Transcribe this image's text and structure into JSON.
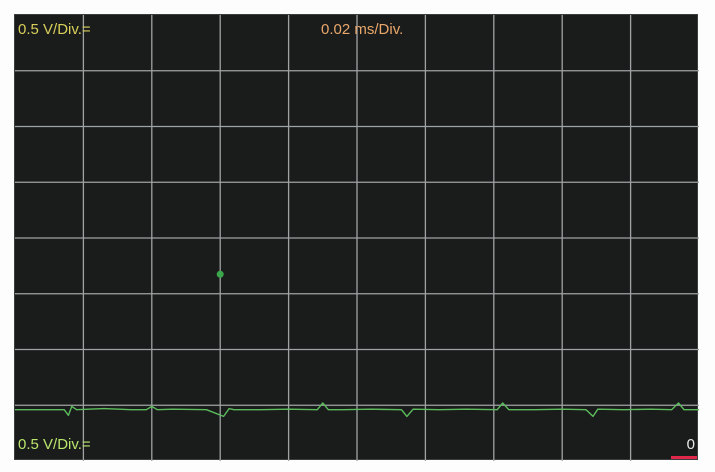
{
  "display": {
    "voltage_per_div_top": "0.5 V/Div.=",
    "time_per_div": "0.02 ms/Div.",
    "voltage_per_div_bottom": "0.5 V/Div.=",
    "zero_marker": "0"
  },
  "colors": {
    "screen_background": "#1a1c1c",
    "grid": "#9fa3a3",
    "trace": "#5cbc5c",
    "cursor_dot": "#3aa84a",
    "readout_volt": "#d8cf5a",
    "readout_time": "#e9a76a",
    "readout_volt_bottom": "#b9e56a",
    "zero_marker": "#e9e9e9",
    "zero_underline": "#e2284a"
  },
  "chart_data": {
    "type": "line",
    "title": "",
    "xlabel": "",
    "ylabel": "",
    "grid": true,
    "divisions": {
      "x": 10,
      "y": 8
    },
    "x_units": "div",
    "y_units": "div",
    "xlim": [
      0,
      10
    ],
    "ylim": [
      -4,
      4
    ],
    "series": [
      {
        "x": [
          0,
          0.45,
          0.72,
          0.78,
          0.83,
          0.9,
          1.3,
          1.7,
          1.92,
          2.0,
          2.08,
          2.3,
          2.8,
          3.05,
          3.13,
          3.2,
          3.6,
          4.0,
          4.42,
          4.5,
          4.58,
          4.8,
          5.2,
          5.65,
          5.73,
          5.82,
          6.2,
          6.6,
          7.05,
          7.13,
          7.22,
          7.6,
          8.0,
          8.35,
          8.45,
          8.52,
          8.9,
          9.3,
          9.6,
          9.7,
          9.78,
          10.0
        ],
        "y": [
          -3.08,
          -3.08,
          -3.08,
          -3.18,
          -3.02,
          -3.08,
          -3.06,
          -3.08,
          -3.08,
          -3.02,
          -3.08,
          -3.07,
          -3.08,
          -3.2,
          -3.06,
          -3.08,
          -3.08,
          -3.07,
          -3.08,
          -2.96,
          -3.08,
          -3.08,
          -3.07,
          -3.08,
          -3.2,
          -3.07,
          -3.08,
          -3.07,
          -3.08,
          -2.96,
          -3.08,
          -3.08,
          -3.07,
          -3.08,
          -3.2,
          -3.07,
          -3.08,
          -3.07,
          -3.08,
          -2.96,
          -3.08,
          -3.08
        ]
      }
    ],
    "annotations": [
      {
        "type": "point",
        "x": 3.0,
        "y": -0.65
      }
    ]
  }
}
